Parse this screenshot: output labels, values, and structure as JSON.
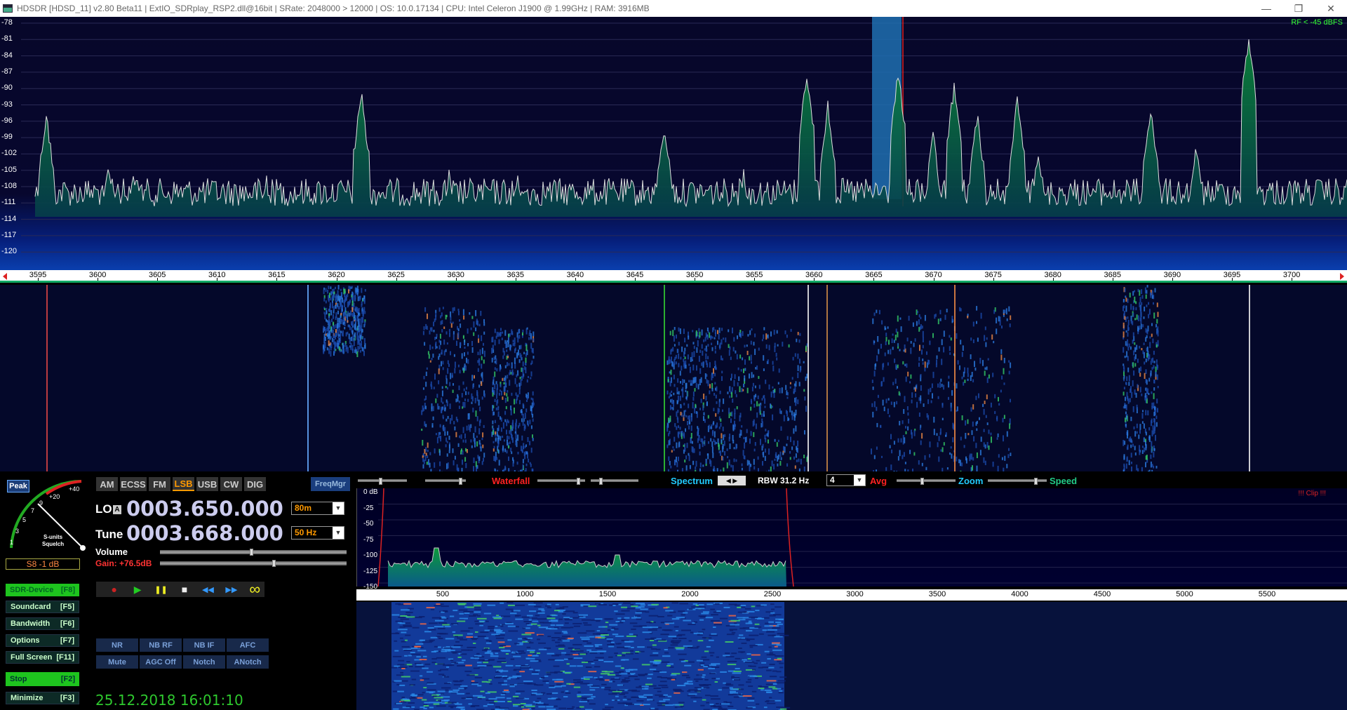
{
  "titlebar": {
    "title": "HDSDR  [HDSD_11]  v2.80 Beta11  |  ExtIO_SDRplay_RSP2.dll@16bit  |  SRate: 2048000 > 12000  |  OS: 10.0.17134   |  CPU: Intel Celeron  J1900  @ 1.99GHz  |  RAM: 3916MB",
    "minimize": "—",
    "restore": "❐",
    "close": "✕"
  },
  "spectrum": {
    "db_labels": [
      "-78",
      "-81",
      "-84",
      "-87",
      "-90",
      "-93",
      "-96",
      "-99",
      "-102",
      "-105",
      "-108",
      "-111",
      "-114",
      "-117",
      "-120"
    ],
    "rf_indicator": "RF < -45 dBFS"
  },
  "freq_axis": {
    "ticks": [
      "3595",
      "3600",
      "3605",
      "3610",
      "3615",
      "3620",
      "3625",
      "3630",
      "3635",
      "3640",
      "3645",
      "3650",
      "3655",
      "3660",
      "3665",
      "3670",
      "3675",
      "3680",
      "3685",
      "3690",
      "3695",
      "3700"
    ]
  },
  "smeter": {
    "peak": "Peak",
    "scale": [
      "1",
      "3",
      "5",
      "7",
      "9",
      "+20",
      "+40"
    ],
    "label_line1": "S-units",
    "label_line2": "Squelch",
    "readout": "S8 -1 dB"
  },
  "left_buttons": [
    {
      "label": "SDR-Device",
      "key": "[F8]"
    },
    {
      "label": "Soundcard",
      "key": "[F5]"
    },
    {
      "label": "Bandwidth",
      "key": "[F6]"
    },
    {
      "label": "Options",
      "key": "[F7]"
    },
    {
      "label": "Full Screen",
      "key": "[F11]"
    },
    {
      "label": "Stop",
      "key": "[F2]"
    },
    {
      "label": "Minimize",
      "key": "[F3]"
    }
  ],
  "modes": [
    "AM",
    "ECSS",
    "FM",
    "LSB",
    "USB",
    "CW",
    "DIG"
  ],
  "freqmgr": "FreqMgr",
  "lo": {
    "label": "LO",
    "badge": "A",
    "value": "0003.650.000",
    "band": "80m"
  },
  "tune": {
    "label": "Tune",
    "value": "0003.668.000",
    "step": "50 Hz"
  },
  "volume": {
    "label": "Volume",
    "level": 0.48
  },
  "gain": {
    "label": "Gain: +76.5dB",
    "level": 0.6
  },
  "transport": {
    "record": "●",
    "play": "▶",
    "pause": "❚❚",
    "stop": "■",
    "rewind": "◀◀",
    "forward": "▶▶",
    "loop": "∞"
  },
  "dsp_row1": [
    "NR",
    "NB RF",
    "NB IF",
    "AFC"
  ],
  "dsp_row2": [
    "Mute",
    "AGC Off",
    "Notch",
    "ANotch"
  ],
  "clock": "25.12.2018 16:01:10",
  "audio_bar": {
    "waterfall": "Waterfall",
    "spectrum": "Spectrum",
    "rbw": "RBW 31.2 Hz",
    "avg_value": "4",
    "avg": "Avg",
    "zoom": "Zoom",
    "speed": "Speed"
  },
  "audio_spec": {
    "db_labels": [
      "0 dB",
      "-25",
      "-50",
      "-75",
      "-100",
      "-125",
      "-150"
    ],
    "clip": "!!! Clip !!!",
    "axis_ticks": [
      "500",
      "1000",
      "1500",
      "2000",
      "2500",
      "3000",
      "3500",
      "4000",
      "4500",
      "5000",
      "5500"
    ]
  },
  "colors": {
    "accent_green": "#1ec41e",
    "mode_active": "#ff9900",
    "freq_digits": "#ccccee",
    "spectrum_fill": "#0a7a3a"
  }
}
